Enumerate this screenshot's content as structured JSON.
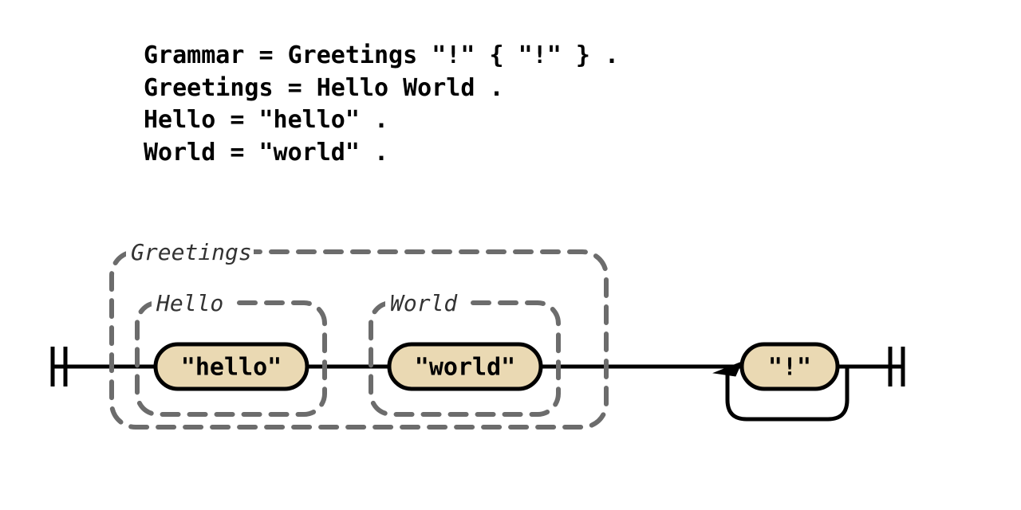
{
  "grammar_lines": [
    "Grammar = Greetings \"!\" { \"!\" } .",
    "Greetings = Hello World .",
    "Hello = \"hello\" .",
    "World = \"world\" ."
  ],
  "diagram": {
    "groups": {
      "greetings": {
        "label": "Greetings"
      },
      "hello": {
        "label": "Hello"
      },
      "world": {
        "label": "World"
      }
    },
    "nodes": {
      "hello_token": "\"hello\"",
      "world_token": "\"world\"",
      "bang_token": "\"!\""
    }
  }
}
